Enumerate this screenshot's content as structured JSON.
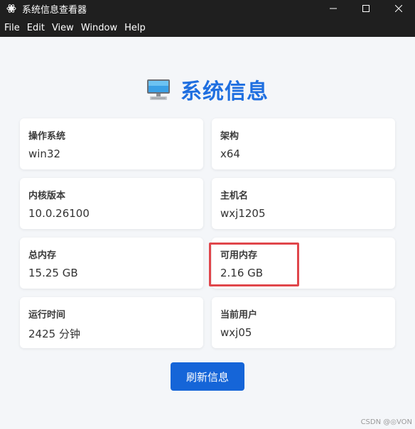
{
  "window": {
    "title": "系统信息查看器",
    "controls": [
      "minimize",
      "maximize",
      "close"
    ]
  },
  "menu": {
    "items": [
      "File",
      "Edit",
      "View",
      "Window",
      "Help"
    ]
  },
  "main": {
    "heading": "系统信息",
    "cards": [
      {
        "label": "操作系统",
        "value": "win32"
      },
      {
        "label": "架构",
        "value": "x64"
      },
      {
        "label": "内核版本",
        "value": "10.0.26100"
      },
      {
        "label": "主机名",
        "value": "wxj1205"
      },
      {
        "label": "总内存",
        "value": "15.25 GB"
      },
      {
        "label": "可用内存",
        "value": "2.16 GB"
      },
      {
        "label": "运行时间",
        "value": "2425 分钟"
      },
      {
        "label": "当前用户",
        "value": "wxj05"
      }
    ],
    "refresh_label": "刷新信息"
  },
  "watermark": "CSDN @◎VON",
  "colors": {
    "accent": "#1f6fe0",
    "button": "#1565d8",
    "highlight": "#e0464b",
    "titlebar": "#1f1f1f",
    "background": "#f4f6f9"
  }
}
